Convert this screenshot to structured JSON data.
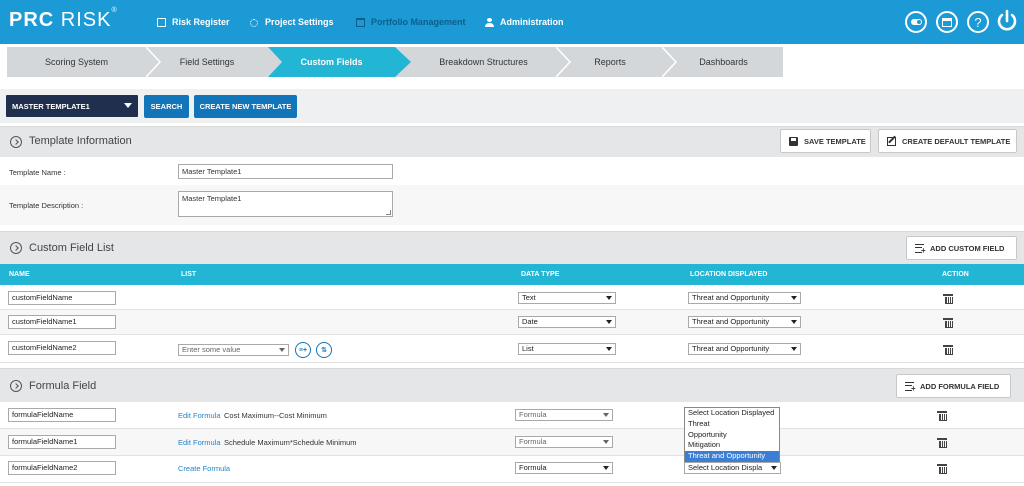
{
  "app": {
    "logo_bold": "PRC",
    "logo_thin": "RISK",
    "logo_mark": "®"
  },
  "topnav": [
    {
      "label": "Risk Register",
      "icon": "document-icon"
    },
    {
      "label": "Project Settings",
      "icon": "gears-icon"
    },
    {
      "label": "Portfolio Management",
      "icon": "folder-icon",
      "disabled": true
    },
    {
      "label": "Administration",
      "icon": "user-icon"
    }
  ],
  "topicons": {
    "help": "?"
  },
  "tabs": [
    {
      "label": "Scoring System"
    },
    {
      "label": "Field Settings"
    },
    {
      "label": "Custom Fields",
      "active": true
    },
    {
      "label": "Breakdown Structures"
    },
    {
      "label": "Reports"
    },
    {
      "label": "Dashboards"
    }
  ],
  "controls": {
    "template_select": "MASTER TEMPLATE1",
    "search": "SEARCH",
    "create_new": "CREATE NEW TEMPLATE"
  },
  "template_info": {
    "title": "Template Information",
    "save": "SAVE TEMPLATE",
    "create_default": "CREATE DEFAULT TEMPLATE",
    "name_label": "Template Name :",
    "name_value": "Master Template1",
    "desc_label": "Template Description :",
    "desc_value": "Master Template1"
  },
  "custom_fields": {
    "title": "Custom Field List",
    "add": "ADD CUSTOM FIELD",
    "headers": {
      "name": "NAME",
      "list": "LIST",
      "data_type": "DATA TYPE",
      "location": "LOCATION DISPLAYED",
      "action": "ACTION"
    },
    "rows": [
      {
        "name": "customFieldName",
        "data_type": "Text",
        "location": "Threat and Opportunity"
      },
      {
        "name": "customFieldName1",
        "data_type": "Date",
        "location": "Threat and Opportunity"
      },
      {
        "name": "customFieldName2",
        "list_placeholder": "Enter some value",
        "data_type": "List",
        "location": "Threat and Opportunity"
      }
    ],
    "list_add_btn": "≡+",
    "list_sort_btn": "⇅"
  },
  "formula_fields": {
    "title": "Formula Field",
    "add": "ADD FORMULA FIELD",
    "rows": [
      {
        "name": "formulaFieldName",
        "link": "Edit Formula",
        "formula": "Cost Maximum--Cost Minimum",
        "data_type": "Formula"
      },
      {
        "name": "formulaFieldName1",
        "link": "Edit Formula",
        "formula": "Schedule Maximum*Schedule Minimum",
        "data_type": "Formula"
      },
      {
        "name": "formulaFieldName2",
        "link": "Create Formula",
        "formula": "",
        "data_type": "Formula",
        "location": "Select Location Displa"
      }
    ],
    "location_options": [
      {
        "label": "Select Location Displayed"
      },
      {
        "label": "Threat"
      },
      {
        "label": "Opportunity"
      },
      {
        "label": "Mitigation"
      },
      {
        "label": "Threat and Opportunity",
        "highlighted": true
      }
    ]
  },
  "colors": {
    "topbar": "#1c9ad6",
    "active_tab": "#22b6d4",
    "table_header": "#22b6d4",
    "dark_select": "#1f2f4d",
    "button_blue": "#1274b9"
  }
}
